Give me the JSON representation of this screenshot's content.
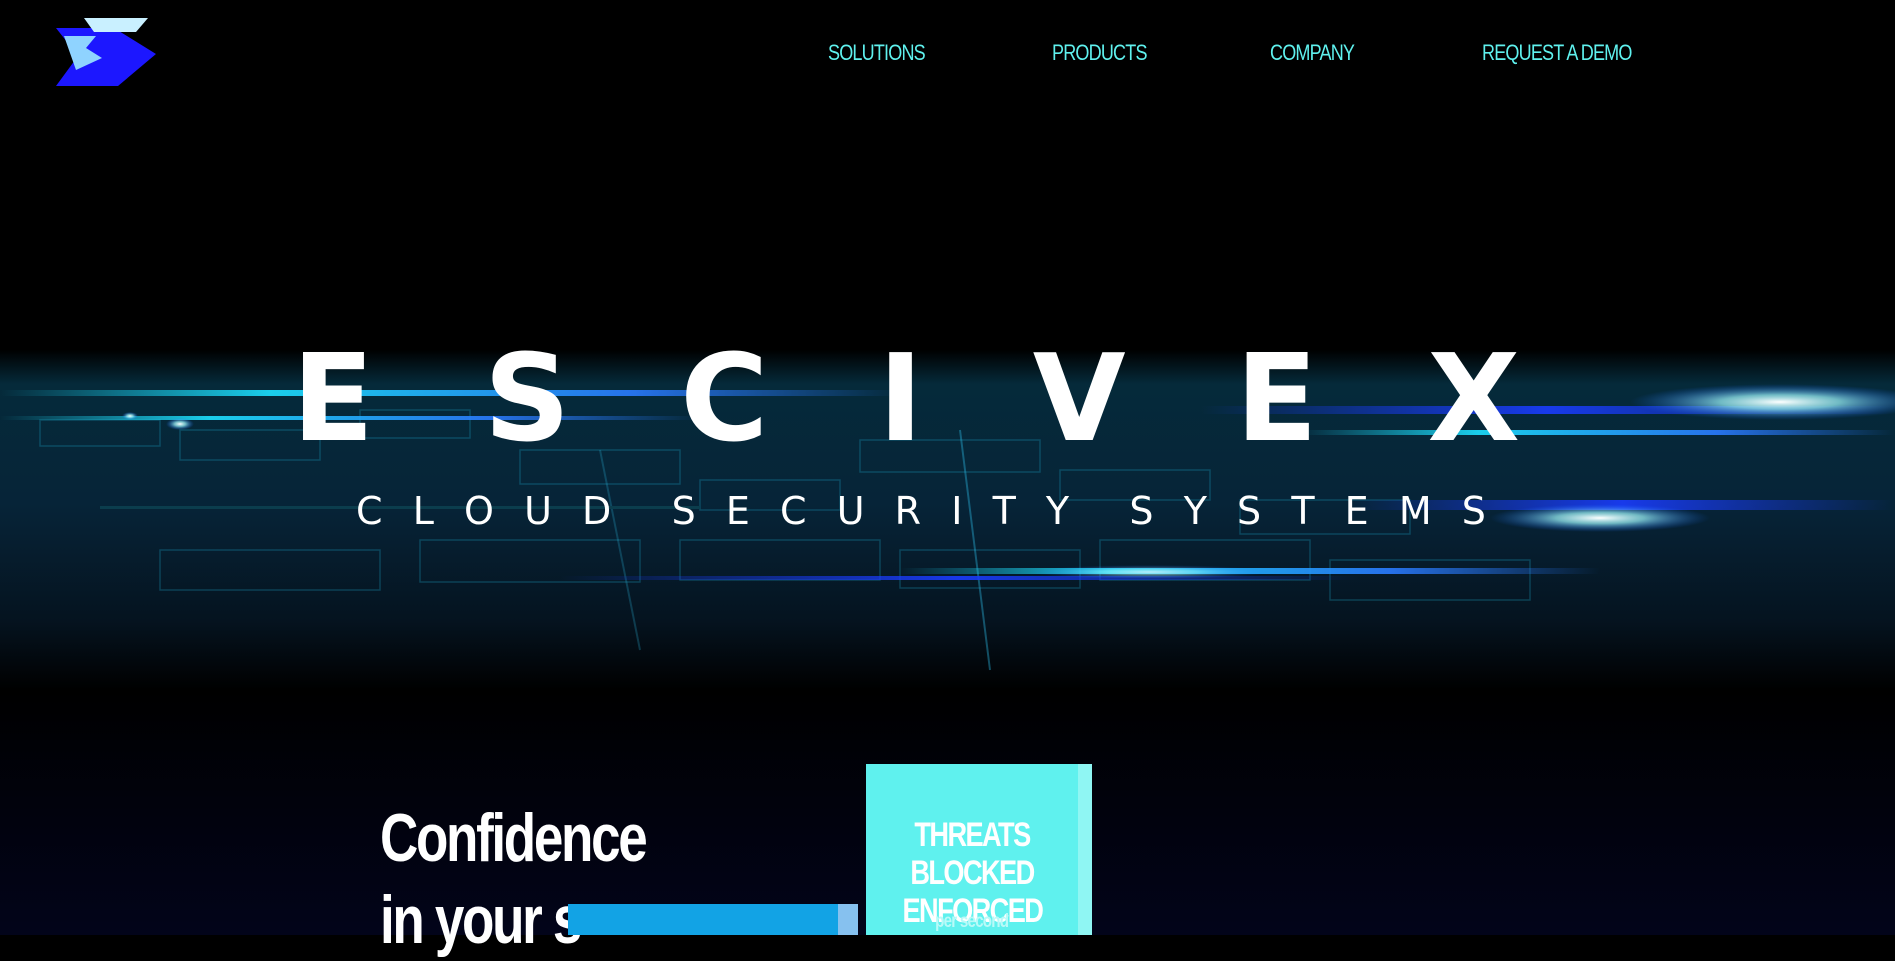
{
  "nav": {
    "logo_icon": "escivex-arrow-logo",
    "items": [
      {
        "label": "SOLUTIONS"
      },
      {
        "label": "PRODUCTS"
      },
      {
        "label": "COMPANY"
      },
      {
        "label": "REQUEST A DEMO"
      }
    ]
  },
  "hero": {
    "title_letters": [
      "E",
      "S",
      "C",
      "I",
      "V",
      "E",
      "X"
    ],
    "subtitle_letters": [
      "C",
      "L",
      "O",
      "U",
      "D",
      "S",
      "E",
      "C",
      "U",
      "R",
      "I",
      "T",
      "Y",
      "S",
      "Y",
      "S",
      "T",
      "E",
      "M",
      "S"
    ],
    "background": "cyber-grid-light-streaks"
  },
  "content": {
    "headline_line1": "Confidence",
    "headline_line2": "in your s",
    "stat_title_line1": "THREATS BLOCKED",
    "stat_title_line2": "ENFORCED",
    "stat_subtitle": "per second"
  },
  "colors": {
    "accent_cyan": "#5ff1ee",
    "logo_blue": "#1c17ff",
    "logo_light": "#8fd3ff",
    "bar_blue": "#12a3e5",
    "background": "#000000"
  }
}
